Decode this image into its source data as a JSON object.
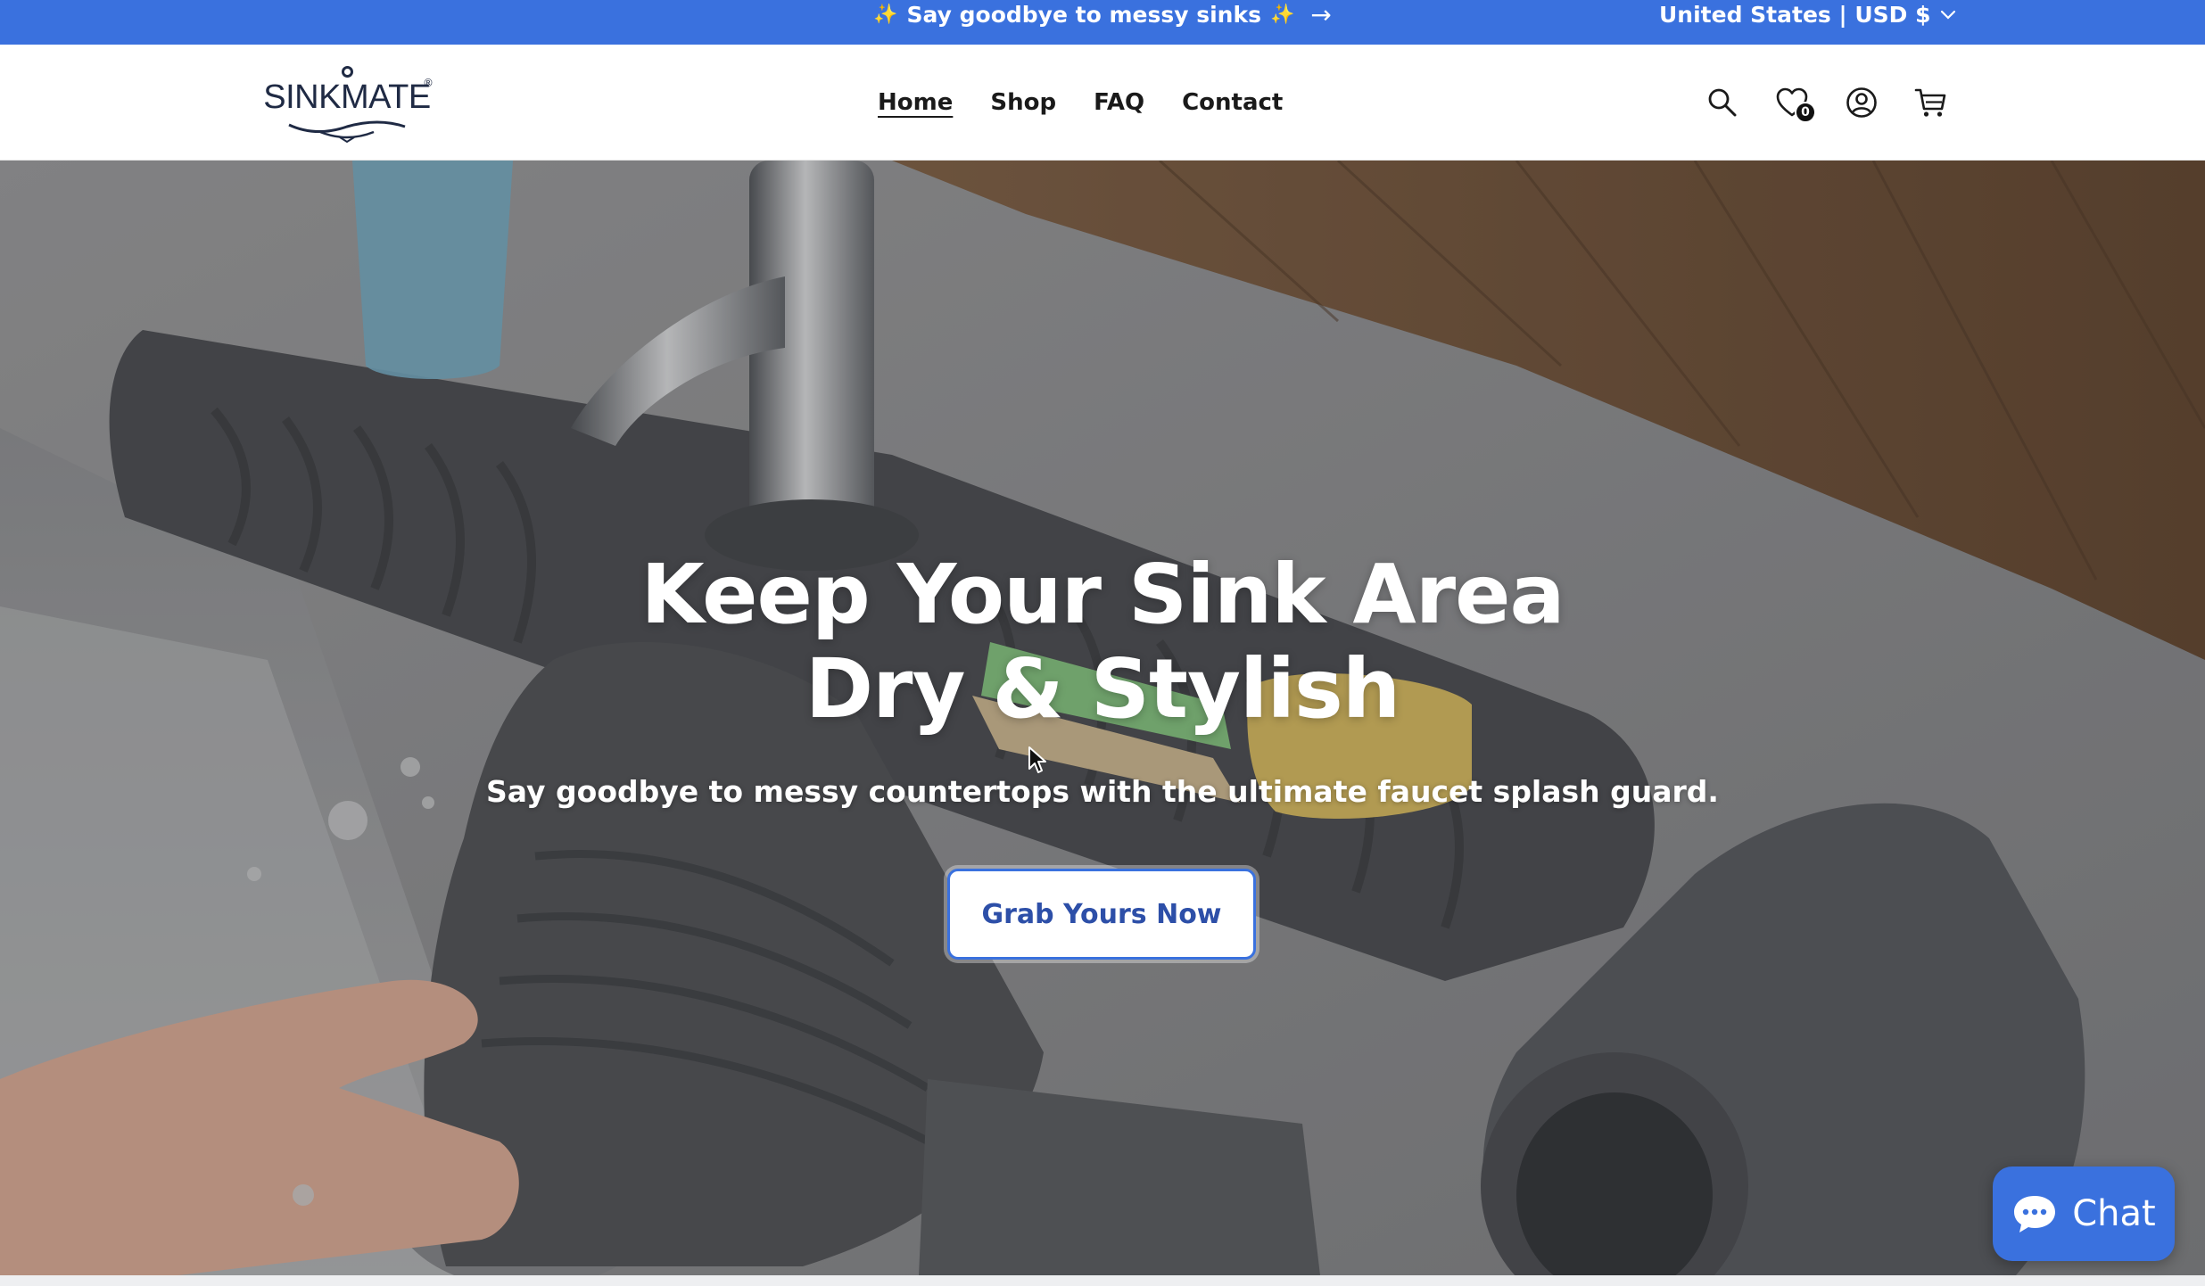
{
  "announcement": {
    "sparkle_left": "✨",
    "text": "Say goodbye to messy sinks",
    "sparkle_right": "✨",
    "arrow": "→"
  },
  "locale": {
    "label": "United States | USD $"
  },
  "header": {
    "logo_text": "SINKMATE",
    "logo_reg": "®",
    "nav": [
      {
        "label": "Home",
        "active": true
      },
      {
        "label": "Shop",
        "active": false
      },
      {
        "label": "FAQ",
        "active": false
      },
      {
        "label": "Contact",
        "active": false
      }
    ],
    "icons": [
      "search-icon",
      "wishlist-heart-icon",
      "account-icon",
      "cart-icon"
    ],
    "wishlist_count": "0"
  },
  "hero": {
    "title_line1": "Keep Your Sink Area",
    "title_line2": "Dry & Stylish",
    "subtitle": "Say goodbye to messy countertops with the ultimate faucet splash guard.",
    "cta_label": "Grab Yours Now"
  },
  "chat": {
    "label": "Chat"
  },
  "colors": {
    "brand_blue": "#3a71de",
    "logo_navy": "#1f2a44"
  }
}
